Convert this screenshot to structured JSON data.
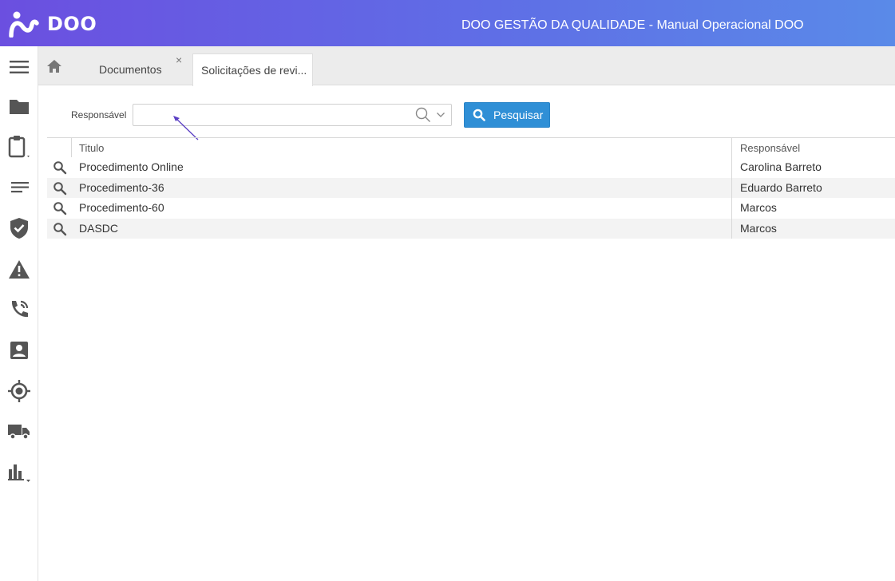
{
  "header": {
    "logo_text": "DOO",
    "app_title": "DOO GESTÃO DA QUALIDADE - Manual Operacional DOO"
  },
  "sidebar": {
    "items": [
      {
        "icon": "menu-icon"
      },
      {
        "icon": "folder-icon"
      },
      {
        "icon": "clipboard-icon"
      },
      {
        "icon": "lines-icon"
      },
      {
        "icon": "shield-check-icon"
      },
      {
        "icon": "warning-icon"
      },
      {
        "icon": "phone-icon"
      },
      {
        "icon": "contact-icon"
      },
      {
        "icon": "target-icon"
      },
      {
        "icon": "truck-icon"
      },
      {
        "icon": "bar-chart-icon"
      }
    ]
  },
  "tabs": {
    "home_icon": "home-icon",
    "items": [
      {
        "label": "Documentos",
        "closable": true
      },
      {
        "label": "Solicitações de revi...",
        "active": true
      }
    ],
    "close_glyph": "×"
  },
  "search": {
    "label": "Responsável",
    "value": "",
    "placeholder": "",
    "button_label": "Pesquisar"
  },
  "table": {
    "columns": [
      "Titulo",
      "Responsável"
    ],
    "rows": [
      {
        "title": "Procedimento Online",
        "responsible": "Carolina Barreto"
      },
      {
        "title": "Procedimento-36",
        "responsible": "Eduardo Barreto"
      },
      {
        "title": "Procedimento-60",
        "responsible": "Marcos"
      },
      {
        "title": "DASDC",
        "responsible": "Marcos"
      }
    ]
  },
  "colors": {
    "header_gradient_start": "#6b4fe0",
    "header_gradient_end": "#5a8ae8",
    "primary_button": "#2f8fd6",
    "sidebar_icon": "#555555",
    "annotation_arrow": "#5b3fc4"
  }
}
